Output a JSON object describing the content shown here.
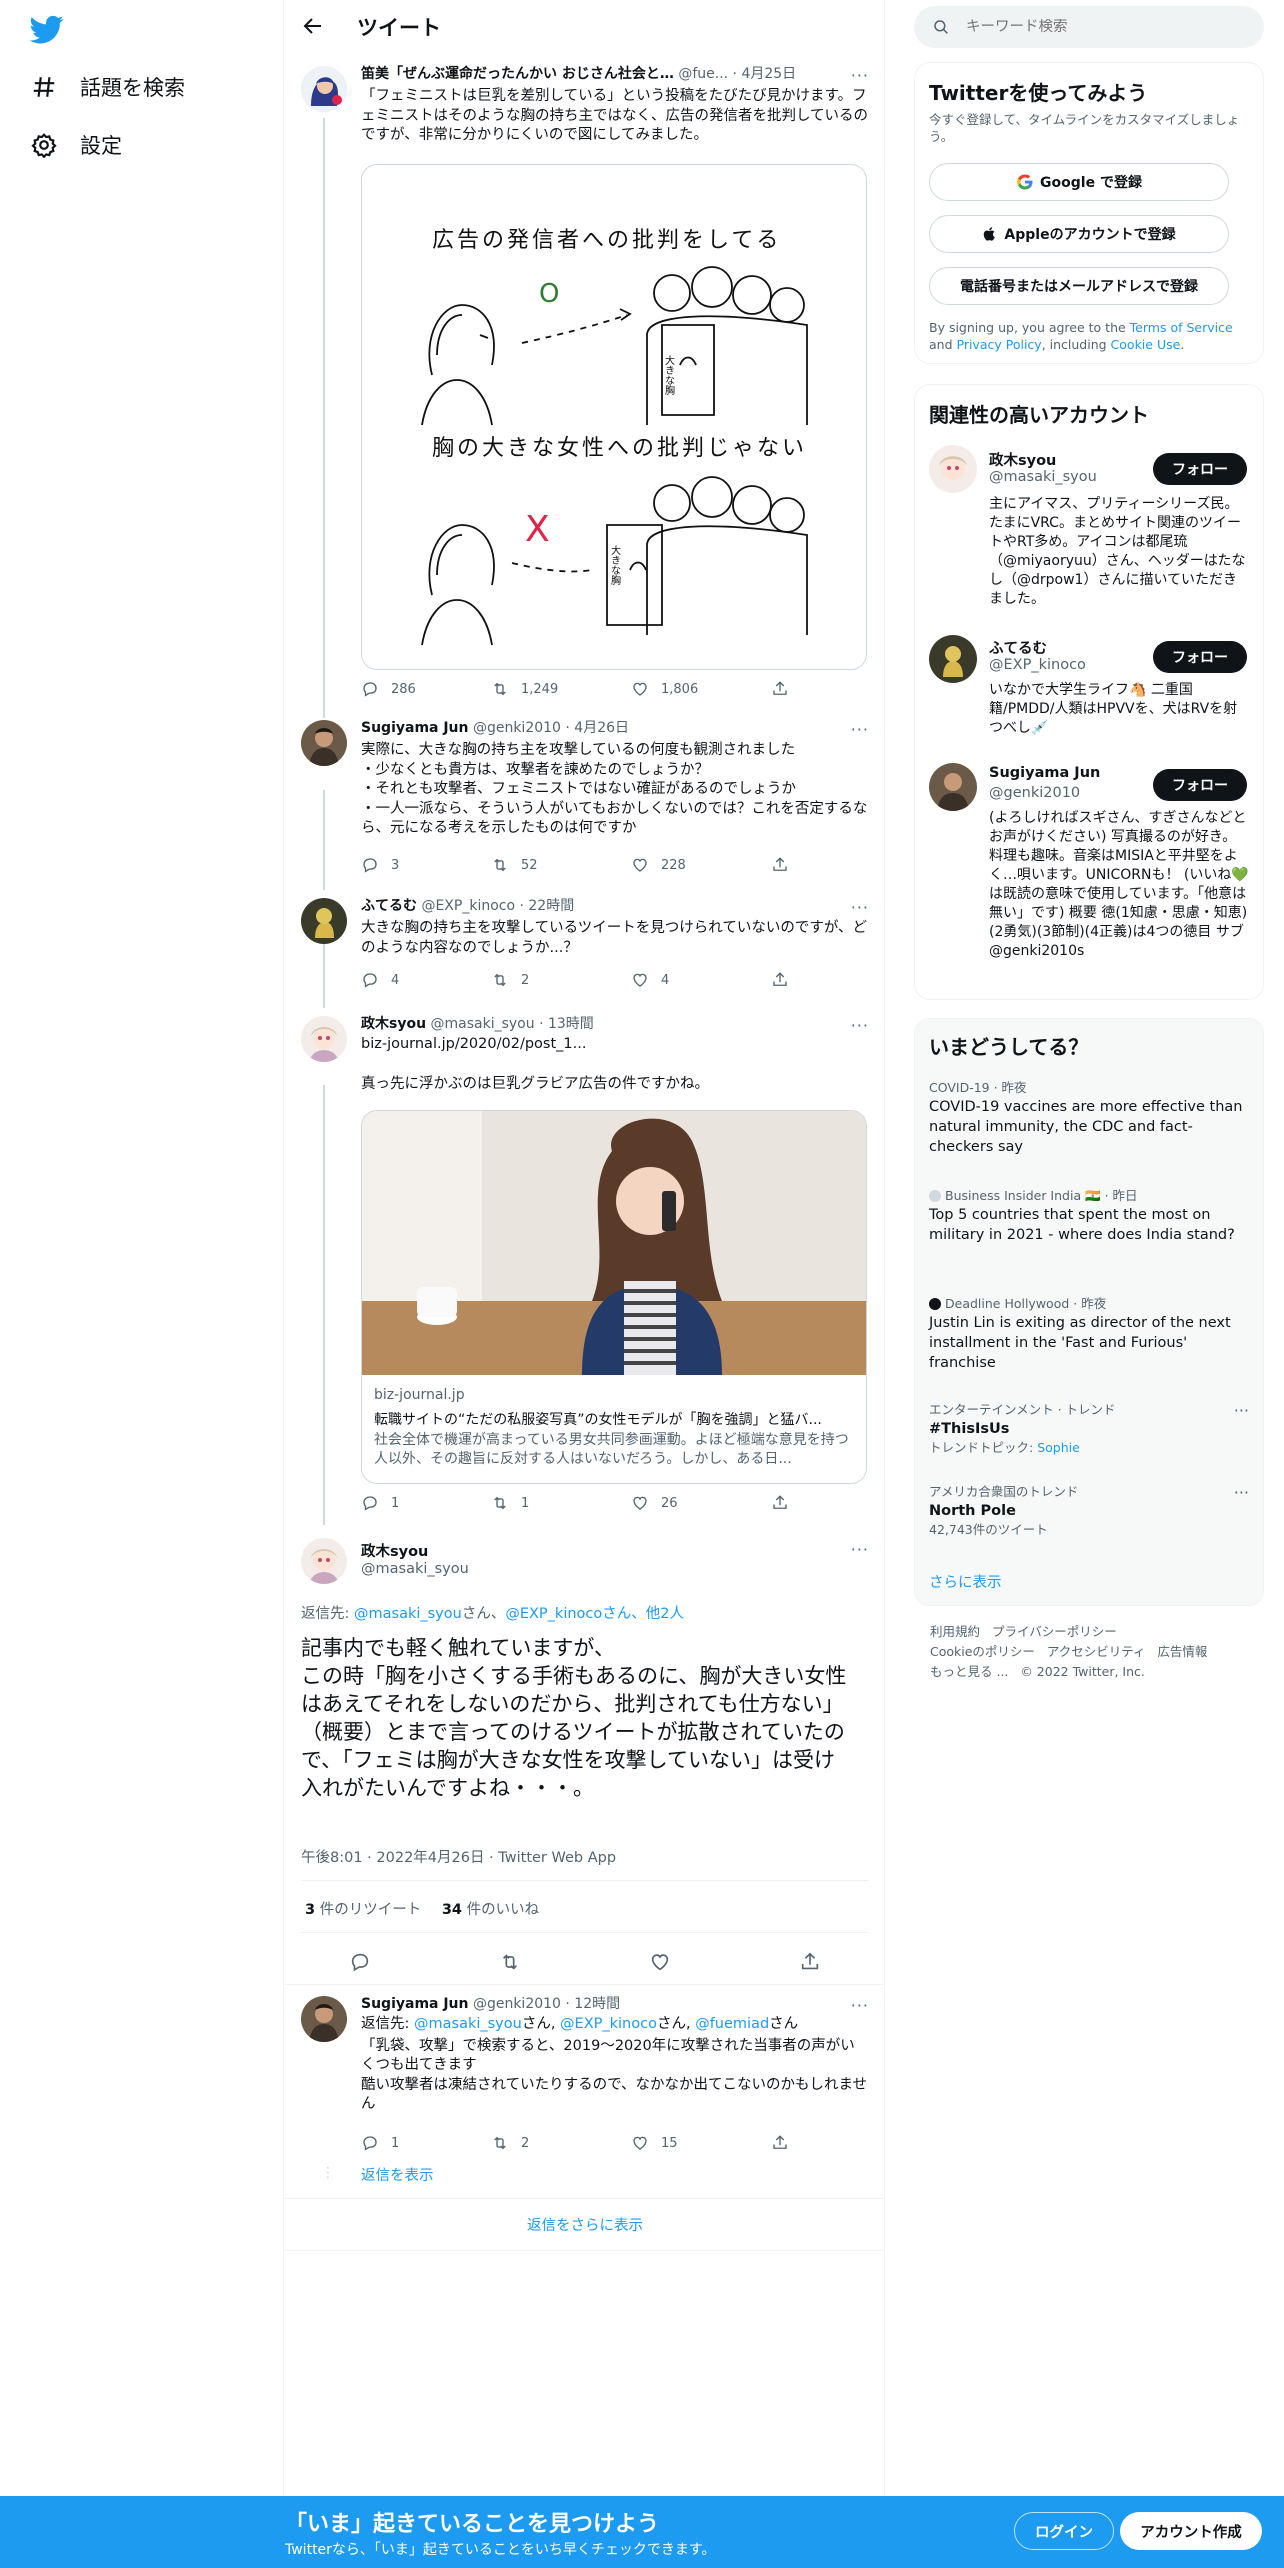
{
  "nav": {
    "explore": "話題を検索",
    "settings": "設定"
  },
  "header": {
    "title": "ツイート"
  },
  "tweets": [
    {
      "name": "笛美「ぜんぶ運命だったんかい おじさん社会と…",
      "handle": "@fue...",
      "time": "· 4月25日",
      "text": "「フェミニストは巨乳を差別している」という投稿をたびたび見かけます。フェミニストはそのような胸の持ち主ではなく、広告の発信者を批判しているのですが、非常に分かりにくいので図にしてみました。",
      "replies": "286",
      "retweets": "1,249",
      "likes": "1,806",
      "drawing": {
        "top": "広告の発信者への批判をしてる",
        "mark_ok": "O",
        "poster_top": "大きな胸",
        "bottom": "胸の大きな女性への批判じゃない",
        "mark_ng": "X",
        "poster_bottom": "大きな胸"
      }
    },
    {
      "name": "Sugiyama Jun",
      "handle": "@genki2010",
      "time": "· 4月26日",
      "text": "実際に、大きな胸の持ち主を攻撃しているの何度も観測されました\n・少なくとも貴方は、攻撃者を諫めたのでしょうか？\n・それとも攻撃者、フェミニストではない確証があるのでしょうか\n・一人一派なら、そういう人がいてもおかしくないのでは？これを否定するなら、元になる考えを示したものは何ですか",
      "replies": "3",
      "retweets": "52",
      "likes": "228"
    },
    {
      "name": "ふてるむ",
      "handle": "@EXP_kinoco",
      "time": "· 22時間",
      "text": "大きな胸の持ち主を攻撃しているツイートを見つけられていないのですが、どのような内容なのでしょうか...？",
      "replies": "4",
      "retweets": "2",
      "likes": "4"
    },
    {
      "name": "政木syou",
      "handle": "@masaki_syou",
      "time": "· 13時間",
      "link": "biz-journal.jp/2020/02/post_1...",
      "text": "真っ先に浮かぶのは巨乳グラビア広告の件ですかね。",
      "card_domain": "biz-journal.jp",
      "card_title": "転職サイトの“ただの私服姿写真”の女性モデルが「胸を強調」と猛バ...",
      "card_desc": "社会全体で機運が高まっている男女共同参画運動。よほど極端な意見を持つ人以外、その趣旨に反対する人はいないだろう。しかし、ある日...",
      "replies": "1",
      "retweets": "1",
      "likes": "26"
    }
  ],
  "focus": {
    "name": "政木syou",
    "handle": "@masaki_syou",
    "reply_prefix": "返信先: ",
    "reply_u1": "@masaki_syou",
    "reply_san1": "さん、",
    "reply_u2": "@EXP_kinocoさん、",
    "reply_u3": "他2人",
    "text": "記事内でも軽く触れていますが、\nこの時「胸を小さくする手術もあるのに、胸が大きい女性はあえてそれをしないのだから、批判されても仕方ない」（概要）とまで言ってのけるツイートが拡散されていたので、「フェミは胸が大きな女性を攻撃していない」は受け入れがたいんですよね・・・。",
    "datetime": "午後8:01 · 2022年4月26日 · Twitter Web App",
    "rt_count": "3",
    "rt_label": " 件のリツイート",
    "like_count": "34",
    "like_label": " 件のいいね"
  },
  "last": {
    "name": "Sugiyama Jun",
    "handle": "@genki2010",
    "time": "· 12時間",
    "reply_prefix": "返信先: ",
    "r1": "@masaki_syou",
    "s1": "さん, ",
    "r2": "@EXP_kinoco",
    "s2": "さん, ",
    "r3": "@fuemiad",
    "s3": "さん",
    "text": "「乳袋、攻撃」で検索すると、2019〜2020年に攻撃された当事者の声がいくつも出てきます\n酷い攻撃者は凍結されていたりするので、なかなか出てこないのかもしれません",
    "replies": "1",
    "retweets": "2",
    "likes": "15",
    "show_replies": "返信を表示"
  },
  "more_replies": "返信をさらに表示",
  "search": {
    "placeholder": "キーワード検索"
  },
  "signup": {
    "title": "Twitterを使ってみよう",
    "subtitle": "今すぐ登録して、タイムラインをカスタマイズしましょう。",
    "google": "Google で登録",
    "apple": "Appleのアカウントで登録",
    "phone": "電話番号またはメールアドレスで登録",
    "terms_a": "By signing up, you agree to the ",
    "terms_tos": "Terms of Service",
    "terms_and": " and ",
    "terms_pp": "Privacy Policy",
    "terms_inc": ", including ",
    "terms_cookie": "Cookie Use",
    "terms_end": "."
  },
  "relevant": {
    "title": "関連性の高いアカウント",
    "follow": "フォロー",
    "accounts": [
      {
        "name": "政木syou",
        "handle": "@masaki_syou",
        "bio": "主にアイマス、プリティーシリーズ民。たまにVRC。まとめサイト関連のツイートやRT多め。アイコンは都尾琉（@miyaoryuu）さん、ヘッダーはたなし（@drpow1）さんに描いていただきました。"
      },
      {
        "name": "ふてるむ",
        "handle": "@EXP_kinoco",
        "bio": "いなかで大学生ライフ🐴 二重国籍/PMDD/人類はHPVVを、犬はRVを射つべし💉"
      },
      {
        "name": "Sugiyama Jun",
        "handle": "@genki2010",
        "bio": "(よろしければスギさん、すぎさんなどとお声がけください) 写真撮るのが好き。料理も趣味。音楽はMISIAと平井堅をよく…唄います。UNICORNも！ (いいね💚は既読の意味で使用しています。「他意は無い」です) 概要 徳(1知慮・思慮・知恵)(2勇気)(3節制)(4正義)は4つの徳目 サブ @genki2010s"
      }
    ]
  },
  "trends": {
    "title": "いまどうしてる？",
    "show_more": "さらに表示",
    "items": [
      {
        "meta": "COVID-19 · 昨夜",
        "desc": "COVID-19 vaccines are more effective than natural immunity, the CDC and fact-checkers say"
      },
      {
        "meta": "Business Insider India 🇮🇳 · 昨日",
        "desc": "Top 5 countries that spent the most on military in 2021 - where does India stand?"
      },
      {
        "meta": "Deadline Hollywood · 昨夜",
        "desc": "Justin Lin is exiting as director of the next installment in the 'Fast and Furious' franchise"
      },
      {
        "meta": "エンターテインメント · トレンド",
        "name": "#ThisIsUs",
        "sub": "トレンドトピック: ",
        "sub_link": "Sophie"
      },
      {
        "meta": "アメリカ合衆国のトレンド",
        "name": "North Pole",
        "sub": "42,743件のツイート"
      }
    ]
  },
  "footer": {
    "l1": "利用規約",
    "l2": "プライバシーポリシー",
    "l3": "Cookieのポリシー",
    "l4": "アクセシビリティ",
    "l5": "広告情報",
    "l6": "もっと見る ...",
    "l7": "© 2022 Twitter, Inc."
  },
  "banner": {
    "title": "「いま」起きていることを見つけよう",
    "sub": "Twitterなら、「いま」起きていることをいち早くチェックできます。",
    "login": "ログイン",
    "signup": "アカウント作成"
  },
  "colors": {
    "accent": "#1d9bf0",
    "text": "#0f1419",
    "muted": "#536471",
    "banner": "#1d9bf0"
  }
}
